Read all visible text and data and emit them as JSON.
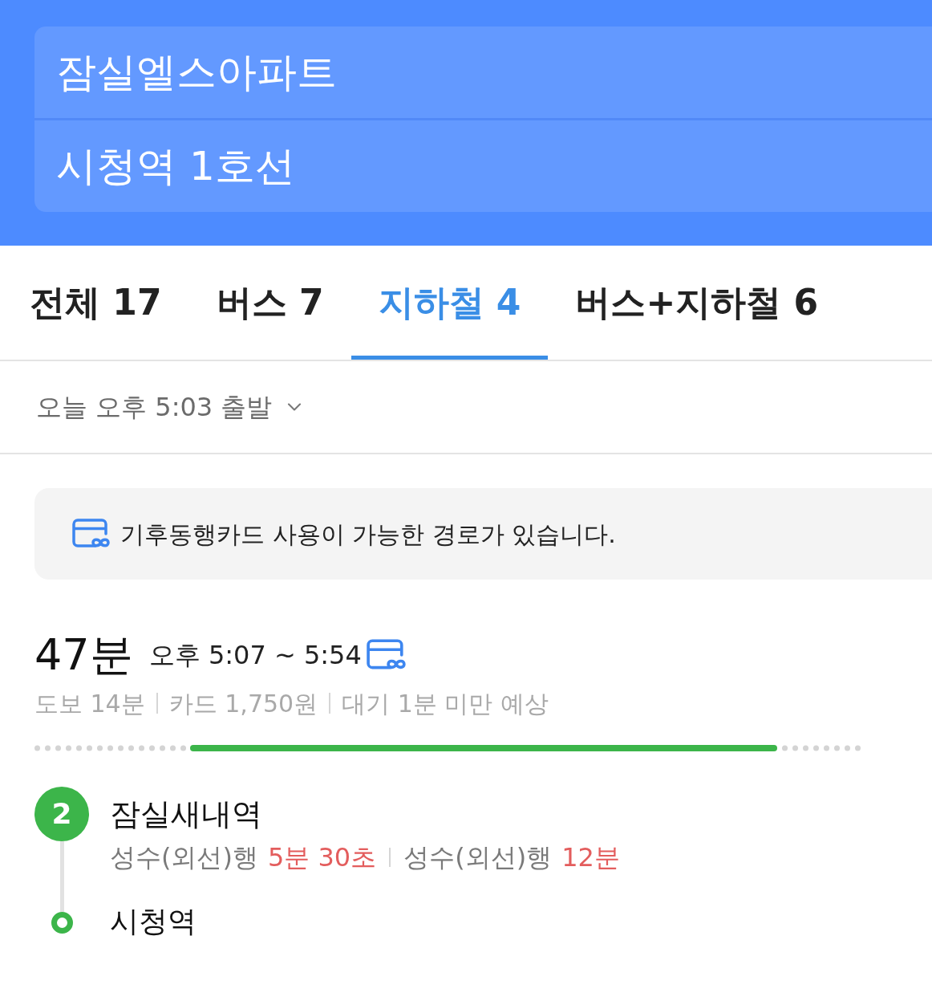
{
  "search": {
    "fields": [
      {
        "value": "잠실엘스아파트"
      },
      {
        "value": "시청역 1호선"
      }
    ]
  },
  "tabs": [
    {
      "label": "전체 17",
      "selected": false
    },
    {
      "label": "버스 7",
      "selected": false
    },
    {
      "label": "지하철 4",
      "selected": true
    },
    {
      "label": "버스+지하철 6",
      "selected": false
    }
  ],
  "departure": {
    "label": "오늘 오후 5:03 출발"
  },
  "notice": {
    "text": "기후동행카드 사용이 가능한 경로가 있습니다."
  },
  "routes": [
    {
      "duration": "47분",
      "time_range": "오후 5:07 ~ 5:54",
      "card_pass": true,
      "details": [
        "도보 14분",
        "카드 1,750원",
        "대기 1분 미만 예상"
      ],
      "stops": [
        {
          "kind": "boarding",
          "line": "2",
          "color": "#3cb54a",
          "name": "잠실새내역",
          "arrivals": [
            {
              "destination": "성수(외선)행",
              "eta": "5분 30초"
            },
            {
              "destination": "성수(외선)행",
              "eta": "12분"
            }
          ]
        },
        {
          "kind": "end",
          "color": "#3cb54a",
          "name": "시청역"
        }
      ]
    }
  ]
}
